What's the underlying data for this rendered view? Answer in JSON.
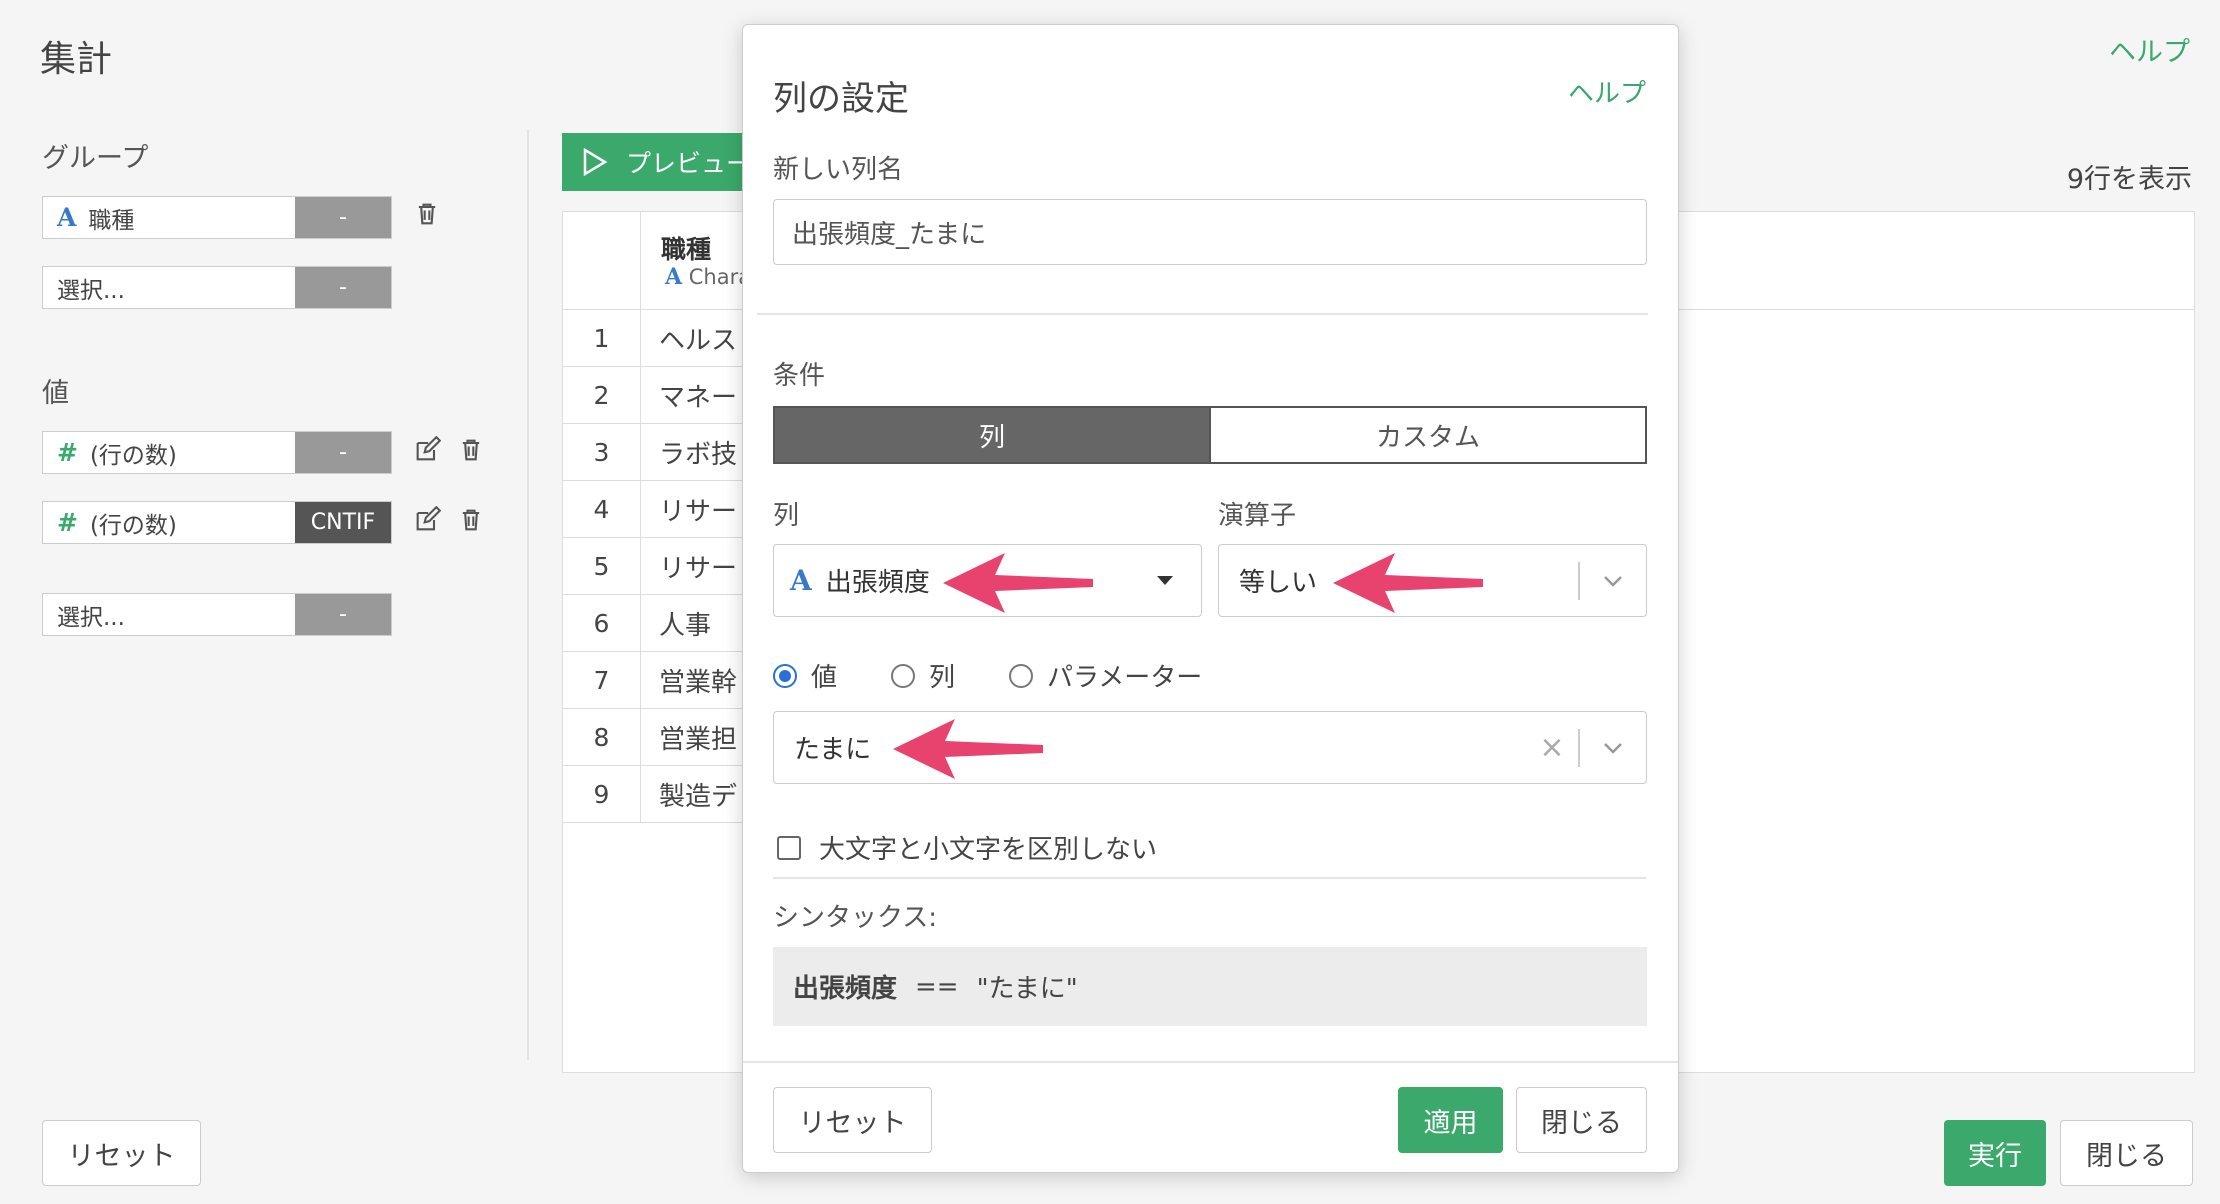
{
  "page": {
    "title": "集計",
    "help": "ヘルプ",
    "row_count": "9行を表示",
    "preview_label": "プレビュー"
  },
  "sidebar": {
    "group_label": "グループ",
    "groups": [
      {
        "type_icon": "A",
        "text": "職種",
        "btn": "-"
      },
      {
        "type_icon": "",
        "text": "選択...",
        "btn": "-"
      }
    ],
    "value_label": "値",
    "values": [
      {
        "type_icon": "#",
        "text": "(行の数)",
        "btn": "-"
      },
      {
        "type_icon": "#",
        "text": "(行の数)",
        "btn": "CNTIF"
      },
      {
        "type_icon": "",
        "text": "選択...",
        "btn": "-"
      }
    ]
  },
  "grid": {
    "column_name": "職種",
    "column_type_icon": "A",
    "column_type": "Chara",
    "rows": [
      {
        "n": "1",
        "v": "ヘルス"
      },
      {
        "n": "2",
        "v": "マネー"
      },
      {
        "n": "3",
        "v": "ラボ技"
      },
      {
        "n": "4",
        "v": "リサー"
      },
      {
        "n": "5",
        "v": "リサー"
      },
      {
        "n": "6",
        "v": "人事"
      },
      {
        "n": "7",
        "v": "営業幹"
      },
      {
        "n": "8",
        "v": "営業担"
      },
      {
        "n": "9",
        "v": "製造デ"
      }
    ]
  },
  "bottom": {
    "reset": "リセット",
    "run": "実行",
    "close": "閉じる"
  },
  "modal": {
    "title": "列の設定",
    "help": "ヘルプ",
    "new_col_label": "新しい列名",
    "new_col_value": "出張頻度_たまに",
    "condition_label": "条件",
    "seg_column": "列",
    "seg_custom": "カスタム",
    "column_label": "列",
    "operator_label": "演算子",
    "column_type_icon": "A",
    "column_value": "出張頻度",
    "operator_value": "等しい",
    "radio_value": "値",
    "radio_column": "列",
    "radio_param": "パラメーター",
    "value_input": "たまに",
    "clear_glyph": "×",
    "case_label": "大文字と小文字を区別しない",
    "syntax_label": "シンタックス:",
    "syntax_col": "出張頻度",
    "syntax_op": "==",
    "syntax_val": "\"たまに\"",
    "reset": "リセット",
    "apply": "適用",
    "close": "閉じる"
  },
  "colors": {
    "accent_green": "#3aa96b",
    "annotation_arrow": "#e8426f",
    "type_a_blue": "#3a79c8"
  }
}
